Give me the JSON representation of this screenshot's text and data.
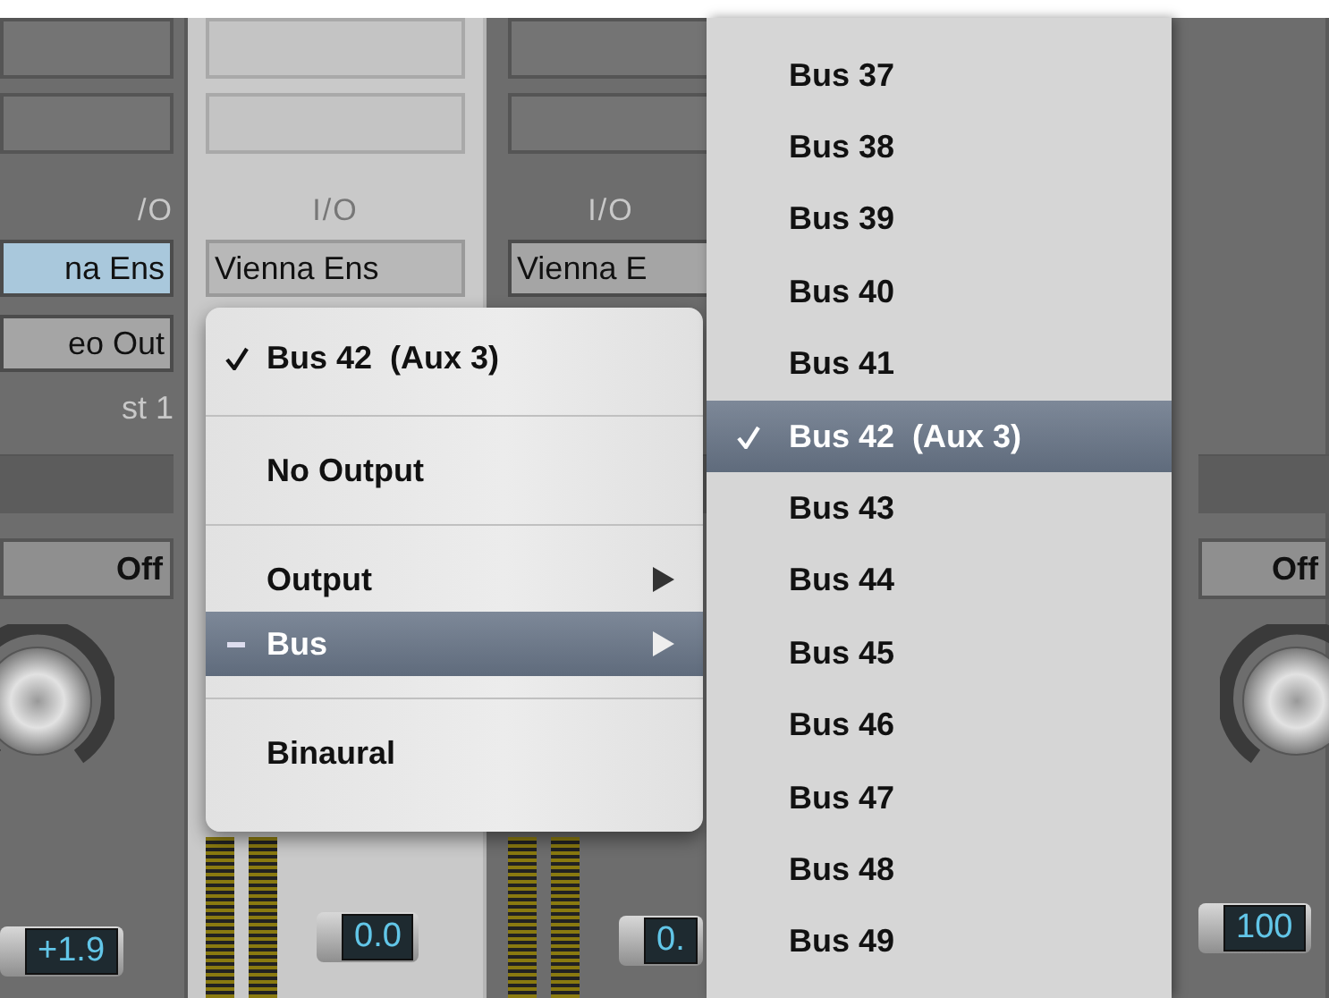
{
  "strips": [
    {
      "selected": false,
      "io_label": "/O",
      "input": {
        "label": "na Ens",
        "highlighted": true
      },
      "output": "eo Out",
      "name": "st 1",
      "automation": "Off",
      "fader_value": "+1.9"
    },
    {
      "selected": true,
      "io_label": "I/O",
      "input": {
        "label": "Vienna Ens",
        "highlighted": false
      },
      "fader_value": "0.0"
    },
    {
      "selected": false,
      "io_label": "I/O",
      "input": {
        "label": "Vienna E",
        "highlighted": false
      },
      "fader_value": "0."
    },
    {
      "selected": false,
      "automation": "Off",
      "fader_value": "100"
    }
  ],
  "output_menu": {
    "items": [
      {
        "kind": "option",
        "label": "Bus 42  (Aux 3)",
        "checked": true,
        "mixed": false,
        "has_submenu": false,
        "selected": false
      },
      {
        "kind": "separator"
      },
      {
        "kind": "option",
        "label": "No Output",
        "checked": false,
        "mixed": false,
        "has_submenu": false,
        "selected": false
      },
      {
        "kind": "separator"
      },
      {
        "kind": "option",
        "label": "Output",
        "checked": false,
        "mixed": false,
        "has_submenu": true,
        "selected": false
      },
      {
        "kind": "option",
        "label": "Bus",
        "checked": false,
        "mixed": true,
        "has_submenu": true,
        "selected": true
      },
      {
        "kind": "separator"
      },
      {
        "kind": "option",
        "label": "Binaural",
        "checked": false,
        "mixed": false,
        "has_submenu": false,
        "selected": false
      }
    ]
  },
  "bus_submenu": {
    "items": [
      {
        "label": "Bus 37",
        "checked": false,
        "selected": false
      },
      {
        "label": "Bus 38",
        "checked": false,
        "selected": false
      },
      {
        "label": "Bus 39",
        "checked": false,
        "selected": false
      },
      {
        "label": "Bus 40",
        "checked": false,
        "selected": false
      },
      {
        "label": "Bus 41",
        "checked": false,
        "selected": false
      },
      {
        "label": "Bus 42  (Aux 3)",
        "checked": true,
        "selected": true
      },
      {
        "label": "Bus 43",
        "checked": false,
        "selected": false
      },
      {
        "label": "Bus 44",
        "checked": false,
        "selected": false
      },
      {
        "label": "Bus 45",
        "checked": false,
        "selected": false
      },
      {
        "label": "Bus 46",
        "checked": false,
        "selected": false
      },
      {
        "label": "Bus 47",
        "checked": false,
        "selected": false
      },
      {
        "label": "Bus 48",
        "checked": false,
        "selected": false
      },
      {
        "label": "Bus 49",
        "checked": false,
        "selected": false
      }
    ]
  }
}
